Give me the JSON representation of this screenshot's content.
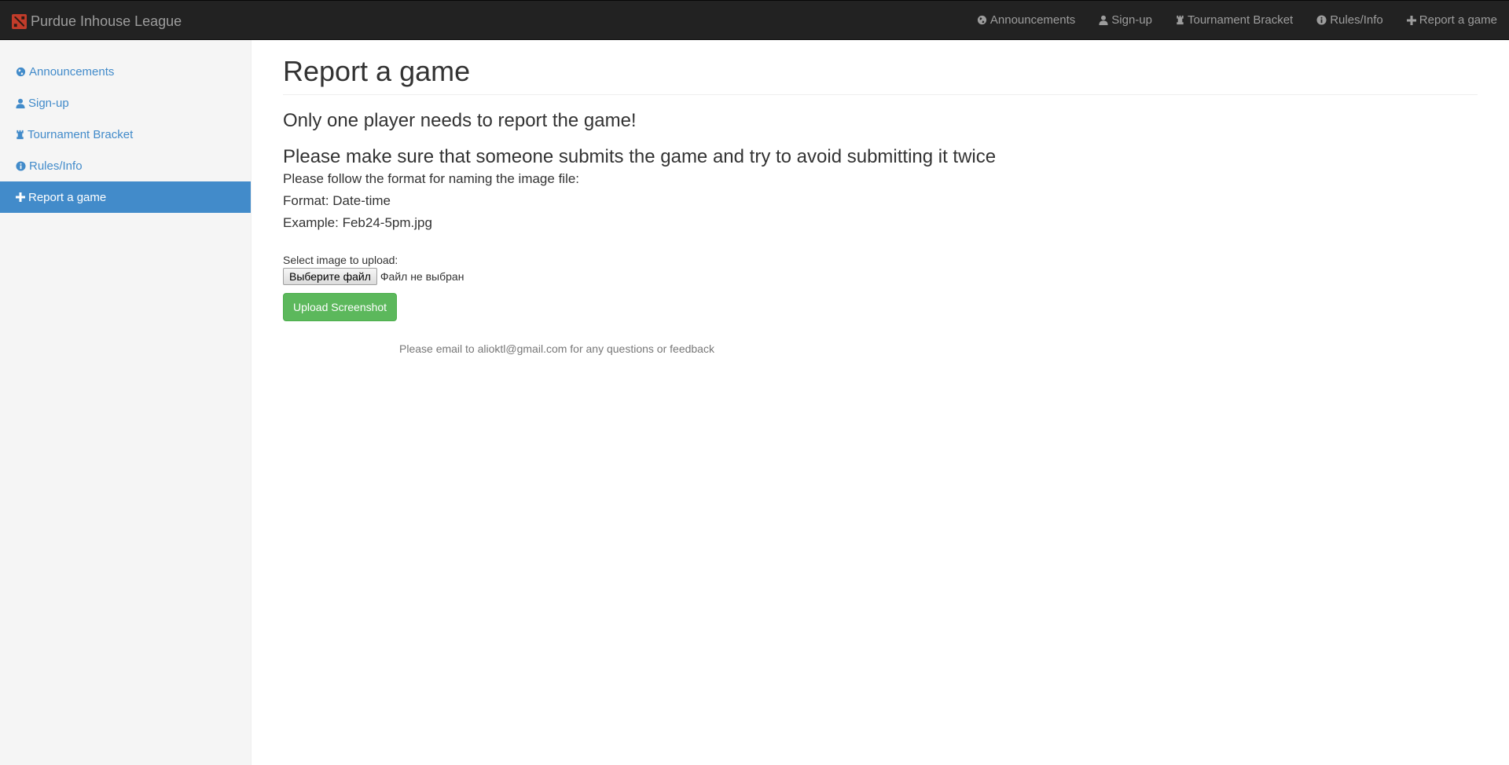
{
  "navbar": {
    "brand": "Purdue Inhouse League",
    "links": [
      "Announcements",
      "Sign-up",
      "Tournament Bracket",
      "Rules/Info",
      "Report a game"
    ]
  },
  "sidebar": {
    "items": [
      "Announcements",
      "Sign-up",
      "Tournament Bracket",
      "Rules/Info",
      "Report a game"
    ],
    "active": "Report a game"
  },
  "main": {
    "title": "Report a game",
    "heading1": "Only one player needs to report the game!",
    "heading2": "Please make sure that someone submits the game and try to avoid submitting it twice",
    "instruction": "Please follow the format for naming the image file:",
    "format": "Format: Date-time",
    "example": "Example: Feb24-5pm.jpg",
    "upload_label": "Select image to upload:",
    "file_button": "Выберите файл",
    "file_status": "Файл не выбран",
    "upload_button": "Upload Screenshot",
    "footer": "Please email to alioktl@gmail.com for any questions or feedback"
  },
  "colors": {
    "navbar_bg": "#222222",
    "accent": "#428bca",
    "success": "#5cb85c"
  },
  "icons": [
    "globe-icon",
    "user-icon",
    "rook-icon",
    "info-icon",
    "plus-icon",
    "dota-logo-icon"
  ]
}
